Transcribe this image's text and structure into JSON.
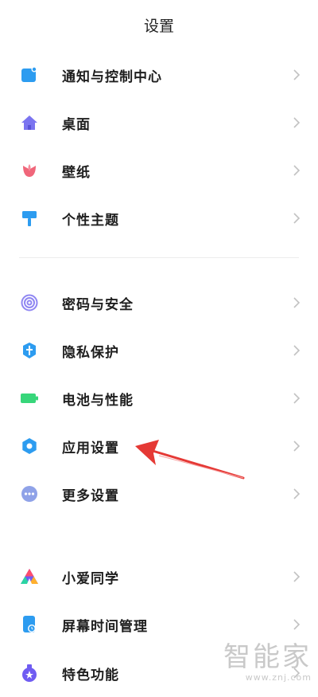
{
  "header": {
    "title": "设置"
  },
  "groups": [
    {
      "items": [
        {
          "label": "通知与控制中心",
          "icon": "notification-icon",
          "color": "#2d9cf0"
        },
        {
          "label": "桌面",
          "icon": "home-icon",
          "color": "#7b74f0"
        },
        {
          "label": "壁纸",
          "icon": "tulip-icon",
          "color": "#f0667a"
        },
        {
          "label": "个性主题",
          "icon": "paint-roller-icon",
          "color": "#2d9cf0"
        }
      ]
    },
    {
      "items": [
        {
          "label": "密码与安全",
          "icon": "fingerprint-icon",
          "color": "#8f86f2"
        },
        {
          "label": "隐私保护",
          "icon": "privacy-shield-icon",
          "color": "#2d9cf0"
        },
        {
          "label": "电池与性能",
          "icon": "battery-icon",
          "color": "#37d67a"
        },
        {
          "label": "应用设置",
          "icon": "gear-icon",
          "color": "#2d9cf0"
        },
        {
          "label": "更多设置",
          "icon": "more-icon",
          "color": "#8fa2e8"
        }
      ]
    },
    {
      "items": [
        {
          "label": "小爱同学",
          "icon": "xiaoai-icon",
          "color": "#6f5cf2"
        },
        {
          "label": "屏幕时间管理",
          "icon": "screen-time-icon",
          "color": "#2d9cf0"
        },
        {
          "label": "特色功能",
          "icon": "features-icon",
          "color": "#6f5cf2"
        }
      ]
    }
  ],
  "annotation": {
    "arrow_color": "#e53935"
  },
  "watermark": {
    "main": "智能家",
    "url": "www.znj.com"
  }
}
